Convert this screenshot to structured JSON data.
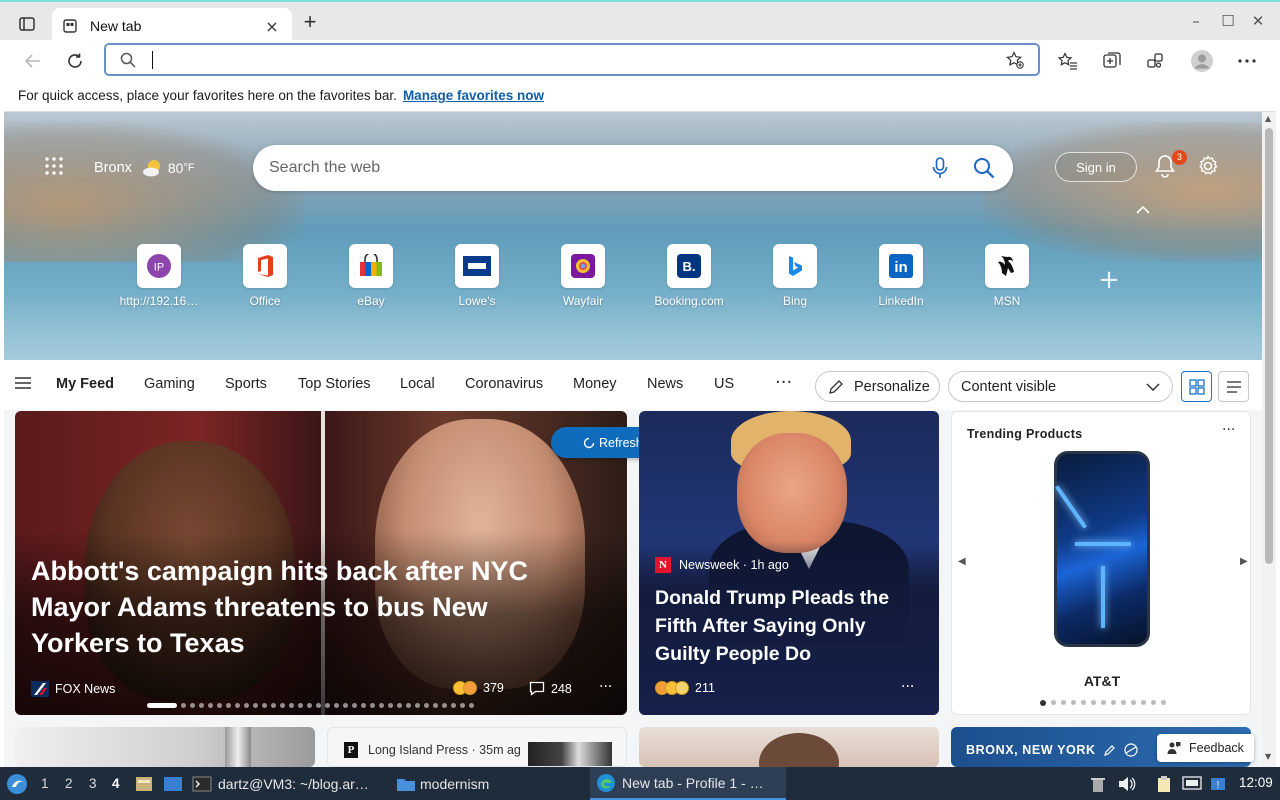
{
  "browser": {
    "tab_title": "New tab",
    "tab_close": "×",
    "new_tab": "+",
    "window_controls": {
      "minimize": "–",
      "maximize": "☐",
      "close": "✕"
    },
    "address_value": "",
    "favorites_bar": {
      "message": "For quick access, place your favorites here on the favorites bar.",
      "link": "Manage favorites now"
    }
  },
  "header": {
    "location": "Bronx",
    "temperature": "80",
    "unit": "°F",
    "search_placeholder": "Search the web",
    "sign_in": "Sign in",
    "notification_count": "3"
  },
  "quick_links": [
    {
      "label": "http://192.16…",
      "icon": "ip-icon"
    },
    {
      "label": "Office",
      "icon": "office-icon"
    },
    {
      "label": "eBay",
      "icon": "ebay-icon"
    },
    {
      "label": "Lowe's",
      "icon": "lowes-icon"
    },
    {
      "label": "Wayfair",
      "icon": "wayfair-icon"
    },
    {
      "label": "Booking.com",
      "icon": "booking-icon"
    },
    {
      "label": "Bing",
      "icon": "bing-icon"
    },
    {
      "label": "LinkedIn",
      "icon": "linkedin-icon"
    },
    {
      "label": "MSN",
      "icon": "msn-icon"
    }
  ],
  "ip_tile_text": "IP",
  "booking_tile_text": "B.",
  "linkedin_tile_text": "in",
  "feed_nav": {
    "items": [
      "My Feed",
      "Gaming",
      "Sports",
      "Top Stories",
      "Local",
      "Coronavirus",
      "Money",
      "News",
      "US"
    ],
    "more": "···",
    "personalize": "Personalize",
    "content_visibility": "Content visible"
  },
  "refresh_label": "Refresh stories",
  "stories": {
    "main": {
      "headline": "Abbott's campaign hits back after NYC Mayor Adams threatens to bus New Yorkers to Texas",
      "source": "FOX News",
      "reactions": "379",
      "comments": "248"
    },
    "second": {
      "source": "Newsweek · 1h ago",
      "source_logo": "N",
      "headline": "Donald Trump Pleads the Fifth After Saying Only Guilty People Do",
      "reactions": "211"
    },
    "trending": {
      "title": "Trending Products",
      "brand": "AT&T"
    },
    "row2_source": "Long Island Press · 35m ag",
    "row2_logo": "P",
    "weather_card": "BRONX, NEW YORK",
    "feedback": "Feedback"
  },
  "taskbar": {
    "workspaces": [
      "1",
      "2",
      "3",
      "4"
    ],
    "terminal": "dartz@VM3: ~/blog.ar…",
    "folder": "modernism",
    "browser_task": "New tab - Profile 1 - …",
    "clock": "12:09"
  }
}
